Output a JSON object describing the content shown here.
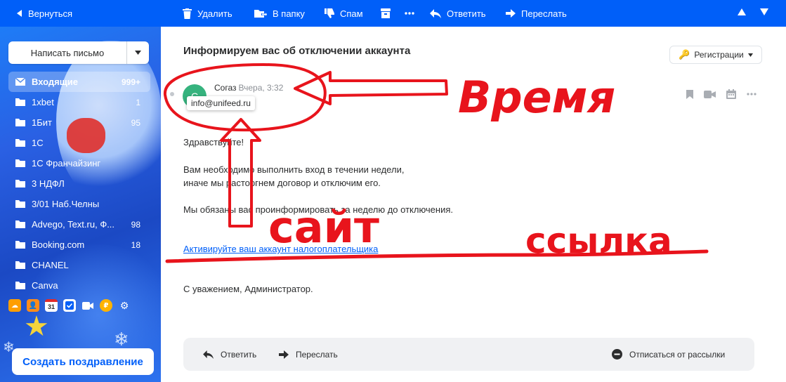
{
  "toolbar": {
    "back": "Вернуться",
    "delete": "Удалить",
    "to_folder": "В папку",
    "spam": "Спам",
    "reply": "Ответить",
    "forward": "Переслать"
  },
  "sidebar": {
    "compose": "Написать письмо",
    "folders": [
      {
        "label": "Входящие",
        "count": "999+"
      },
      {
        "label": "1xbet",
        "count": "1"
      },
      {
        "label": "1Бит",
        "count": "95"
      },
      {
        "label": "1С",
        "count": ""
      },
      {
        "label": "1С Франчайзинг",
        "count": ""
      },
      {
        "label": "3 НДФЛ",
        "count": ""
      },
      {
        "label": "3/01 Наб.Челны",
        "count": ""
      },
      {
        "label": "Advego, Text.ru, Ф...",
        "count": "98"
      },
      {
        "label": "Booking.com",
        "count": "18"
      },
      {
        "label": "CHANEL",
        "count": ""
      },
      {
        "label": "Canva",
        "count": ""
      }
    ],
    "calendar_day": "31",
    "greeting_button": "Создать поздравление"
  },
  "message": {
    "subject": "Информируем вас об отключении аккаунта",
    "label_button": "Регистрации",
    "avatar_letter": "С",
    "sender": "Согаз",
    "time": "Вчера, 3:32",
    "sender_email": "info@unifeed.ru",
    "greeting": "Здравствуйте!",
    "line1": "Вам необходимо выполнить вход в течении недели,",
    "line2": "иначе мы расторгнем договор и отключим его.",
    "line3": "Мы обязаны вас проинформировать за неделю до отключения.",
    "link": "Активируйте ваш аккаунт налогоплательщика",
    "signature": "С уважением, Администратор."
  },
  "footer": {
    "reply": "Ответить",
    "forward": "Переслать",
    "unsubscribe": "Отписаться от рассылки"
  },
  "annotations": {
    "time": "Время",
    "site": "сайт",
    "link": "ссылка",
    "color": "#e8141c"
  }
}
